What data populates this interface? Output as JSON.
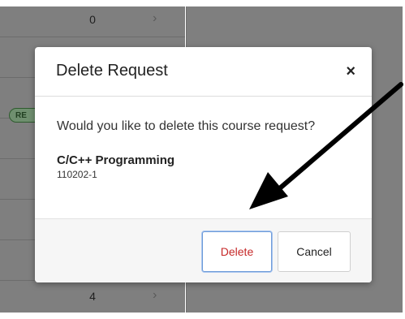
{
  "background": {
    "rows": [
      {
        "value": "0"
      },
      {
        "value": "4"
      }
    ],
    "badge_text": "RE"
  },
  "modal": {
    "title": "Delete Request",
    "close_label": "×",
    "question": "Would you like to delete this course request?",
    "course": {
      "name": "C/C++ Programming",
      "code": "110202-1"
    },
    "buttons": {
      "delete_label": "Delete",
      "cancel_label": "Cancel"
    }
  },
  "colors": {
    "delete_text": "#c62828",
    "focus_border": "#6f9cd9",
    "overlay": "#7f7f7f",
    "arrow": "#000000"
  },
  "icons": {
    "close": "close-icon",
    "row_chevron": "chevron-right-icon",
    "annotation": "arrow-annotation"
  }
}
